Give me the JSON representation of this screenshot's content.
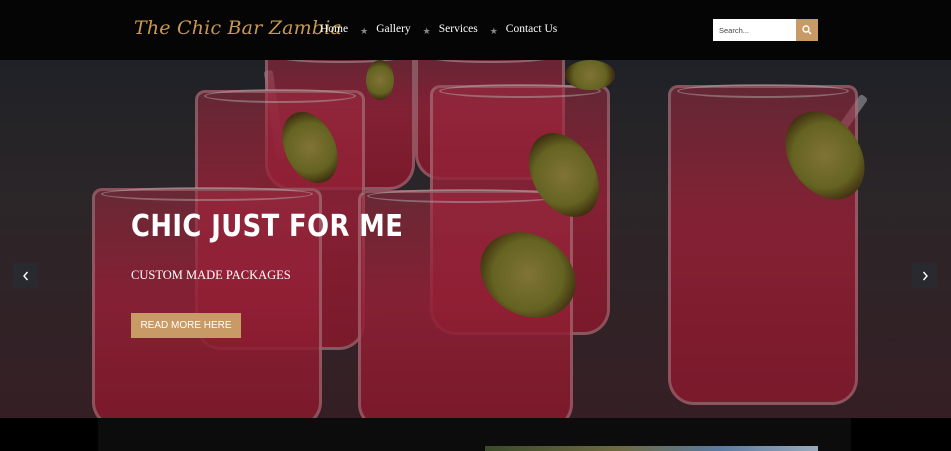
{
  "header": {
    "logo": "The Chic Bar Zambia",
    "nav": [
      {
        "label": "Home"
      },
      {
        "label": "Gallery"
      },
      {
        "label": "Services"
      },
      {
        "label": "Contact Us"
      }
    ],
    "search": {
      "placeholder": "Search..."
    }
  },
  "hero": {
    "title": "CHIC JUST FOR ME",
    "subtitle": "CUSTOM MADE PACKAGES",
    "button": "READ MORE HERE"
  },
  "colors": {
    "accent": "#c89a65",
    "logo": "#c89a4f",
    "header_bg": "#050505"
  },
  "icons": [
    "search-icon",
    "chevron-left-icon",
    "chevron-right-icon",
    "star-separator-icon"
  ]
}
